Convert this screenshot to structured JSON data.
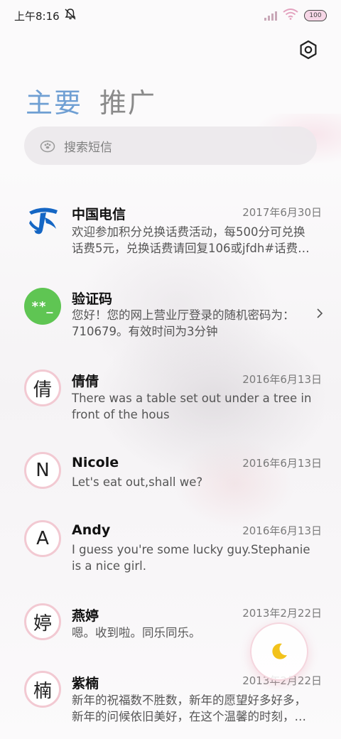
{
  "status_bar": {
    "time": "上午8:16",
    "battery": "100"
  },
  "tabs": [
    {
      "label": "主要",
      "active": true
    },
    {
      "label": "推广",
      "active": false
    }
  ],
  "search": {
    "placeholder": "搜索短信"
  },
  "messages": [
    {
      "sender": "中国电信",
      "date": "2017年6月30日",
      "avatar": "logo",
      "line1": "欢迎参加积分兑换话费活动，每500分可兑换",
      "line2": "话费5元，兑换话费请回复106或jfdh#话费…"
    },
    {
      "sender": "验证码",
      "date": "",
      "avatar": "**_",
      "line1": "您好！您的网上营业厅登录的随机密码为：",
      "line2": "710679。有效时间为3分钟"
    },
    {
      "sender": "倩倩",
      "date": "2016年6月13日",
      "avatar": "倩",
      "line1": "There was a table set out under a tree in",
      "line2": "front of the hous"
    },
    {
      "sender": "Nicole",
      "date": "2016年6月13日",
      "avatar": "N",
      "line1": "Let's eat out,shall we?",
      "line2": ""
    },
    {
      "sender": "Andy",
      "date": "2016年6月13日",
      "avatar": "A",
      "line1": "I guess you're some lucky guy.Stephanie",
      "line2": "is a nice girl."
    },
    {
      "sender": "燕婷",
      "date": "2013年2月22日",
      "avatar": "婷",
      "line1": "嗯。收到啦。同乐同乐。",
      "line2": ""
    },
    {
      "sender": "紫楠",
      "date": "2013年2月22日",
      "avatar": "楠",
      "line1": "新年的祝福数不胜数，新年的愿望好多好多，",
      "line2": "新年的问候依旧美好，在这个温馨的时刻，…"
    }
  ],
  "colors": {
    "tab_active": "#6f9fd3",
    "verify_green": "#5fc553",
    "avatar_ring": "#f2c9d2"
  }
}
